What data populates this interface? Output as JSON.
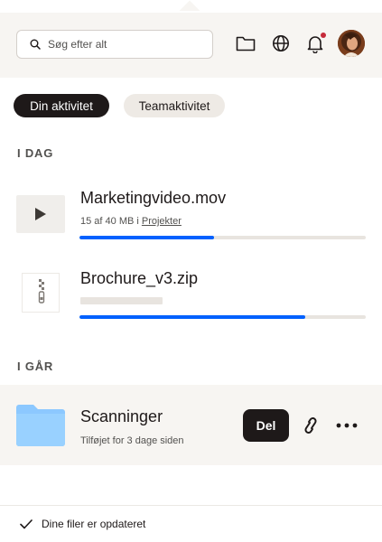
{
  "search": {
    "placeholder": "Søg efter alt"
  },
  "header_icons": [
    "folder-icon",
    "globe-icon",
    "bell-icon",
    "avatar"
  ],
  "notification_badge_color": "#c52a3a",
  "tabs": [
    {
      "label": "Din aktivitet",
      "active": true
    },
    {
      "label": "Teamaktivitet",
      "active": false
    }
  ],
  "sections": {
    "today": "I DAG",
    "yesterday": "I GÅR"
  },
  "uploads": [
    {
      "name": "Marketingvideo.mov",
      "meta_prefix": "15 af 40 MB i ",
      "meta_link": "Projekter",
      "icon": "play-icon",
      "progress": 0.47
    },
    {
      "name": "Brochure_v3.zip",
      "icon": "zip-file-icon",
      "progress": 0.79
    }
  ],
  "yesterday_item": {
    "name": "Scanninger",
    "meta": "Tilføjet for 3 dage siden",
    "icon": "folder-icon",
    "share_label": "Del"
  },
  "footer": {
    "status": "Dine filer er opdateret"
  },
  "colors": {
    "accent": "#0061fe",
    "dark": "#1e1919",
    "folder": "#8cc8ff"
  }
}
